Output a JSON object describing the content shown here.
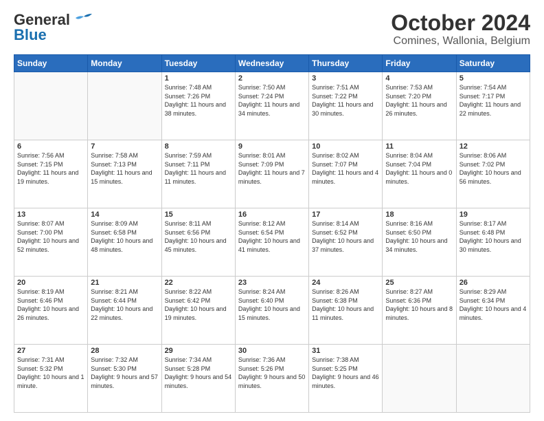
{
  "header": {
    "logo_line1": "General",
    "logo_line2": "Blue",
    "title": "October 2024",
    "subtitle": "Comines, Wallonia, Belgium"
  },
  "weekdays": [
    "Sunday",
    "Monday",
    "Tuesday",
    "Wednesday",
    "Thursday",
    "Friday",
    "Saturday"
  ],
  "weeks": [
    [
      {
        "day": "",
        "sunrise": "",
        "sunset": "",
        "daylight": ""
      },
      {
        "day": "",
        "sunrise": "",
        "sunset": "",
        "daylight": ""
      },
      {
        "day": "1",
        "sunrise": "Sunrise: 7:48 AM",
        "sunset": "Sunset: 7:26 PM",
        "daylight": "Daylight: 11 hours and 38 minutes."
      },
      {
        "day": "2",
        "sunrise": "Sunrise: 7:50 AM",
        "sunset": "Sunset: 7:24 PM",
        "daylight": "Daylight: 11 hours and 34 minutes."
      },
      {
        "day": "3",
        "sunrise": "Sunrise: 7:51 AM",
        "sunset": "Sunset: 7:22 PM",
        "daylight": "Daylight: 11 hours and 30 minutes."
      },
      {
        "day": "4",
        "sunrise": "Sunrise: 7:53 AM",
        "sunset": "Sunset: 7:20 PM",
        "daylight": "Daylight: 11 hours and 26 minutes."
      },
      {
        "day": "5",
        "sunrise": "Sunrise: 7:54 AM",
        "sunset": "Sunset: 7:17 PM",
        "daylight": "Daylight: 11 hours and 22 minutes."
      }
    ],
    [
      {
        "day": "6",
        "sunrise": "Sunrise: 7:56 AM",
        "sunset": "Sunset: 7:15 PM",
        "daylight": "Daylight: 11 hours and 19 minutes."
      },
      {
        "day": "7",
        "sunrise": "Sunrise: 7:58 AM",
        "sunset": "Sunset: 7:13 PM",
        "daylight": "Daylight: 11 hours and 15 minutes."
      },
      {
        "day": "8",
        "sunrise": "Sunrise: 7:59 AM",
        "sunset": "Sunset: 7:11 PM",
        "daylight": "Daylight: 11 hours and 11 minutes."
      },
      {
        "day": "9",
        "sunrise": "Sunrise: 8:01 AM",
        "sunset": "Sunset: 7:09 PM",
        "daylight": "Daylight: 11 hours and 7 minutes."
      },
      {
        "day": "10",
        "sunrise": "Sunrise: 8:02 AM",
        "sunset": "Sunset: 7:07 PM",
        "daylight": "Daylight: 11 hours and 4 minutes."
      },
      {
        "day": "11",
        "sunrise": "Sunrise: 8:04 AM",
        "sunset": "Sunset: 7:04 PM",
        "daylight": "Daylight: 11 hours and 0 minutes."
      },
      {
        "day": "12",
        "sunrise": "Sunrise: 8:06 AM",
        "sunset": "Sunset: 7:02 PM",
        "daylight": "Daylight: 10 hours and 56 minutes."
      }
    ],
    [
      {
        "day": "13",
        "sunrise": "Sunrise: 8:07 AM",
        "sunset": "Sunset: 7:00 PM",
        "daylight": "Daylight: 10 hours and 52 minutes."
      },
      {
        "day": "14",
        "sunrise": "Sunrise: 8:09 AM",
        "sunset": "Sunset: 6:58 PM",
        "daylight": "Daylight: 10 hours and 48 minutes."
      },
      {
        "day": "15",
        "sunrise": "Sunrise: 8:11 AM",
        "sunset": "Sunset: 6:56 PM",
        "daylight": "Daylight: 10 hours and 45 minutes."
      },
      {
        "day": "16",
        "sunrise": "Sunrise: 8:12 AM",
        "sunset": "Sunset: 6:54 PM",
        "daylight": "Daylight: 10 hours and 41 minutes."
      },
      {
        "day": "17",
        "sunrise": "Sunrise: 8:14 AM",
        "sunset": "Sunset: 6:52 PM",
        "daylight": "Daylight: 10 hours and 37 minutes."
      },
      {
        "day": "18",
        "sunrise": "Sunrise: 8:16 AM",
        "sunset": "Sunset: 6:50 PM",
        "daylight": "Daylight: 10 hours and 34 minutes."
      },
      {
        "day": "19",
        "sunrise": "Sunrise: 8:17 AM",
        "sunset": "Sunset: 6:48 PM",
        "daylight": "Daylight: 10 hours and 30 minutes."
      }
    ],
    [
      {
        "day": "20",
        "sunrise": "Sunrise: 8:19 AM",
        "sunset": "Sunset: 6:46 PM",
        "daylight": "Daylight: 10 hours and 26 minutes."
      },
      {
        "day": "21",
        "sunrise": "Sunrise: 8:21 AM",
        "sunset": "Sunset: 6:44 PM",
        "daylight": "Daylight: 10 hours and 22 minutes."
      },
      {
        "day": "22",
        "sunrise": "Sunrise: 8:22 AM",
        "sunset": "Sunset: 6:42 PM",
        "daylight": "Daylight: 10 hours and 19 minutes."
      },
      {
        "day": "23",
        "sunrise": "Sunrise: 8:24 AM",
        "sunset": "Sunset: 6:40 PM",
        "daylight": "Daylight: 10 hours and 15 minutes."
      },
      {
        "day": "24",
        "sunrise": "Sunrise: 8:26 AM",
        "sunset": "Sunset: 6:38 PM",
        "daylight": "Daylight: 10 hours and 11 minutes."
      },
      {
        "day": "25",
        "sunrise": "Sunrise: 8:27 AM",
        "sunset": "Sunset: 6:36 PM",
        "daylight": "Daylight: 10 hours and 8 minutes."
      },
      {
        "day": "26",
        "sunrise": "Sunrise: 8:29 AM",
        "sunset": "Sunset: 6:34 PM",
        "daylight": "Daylight: 10 hours and 4 minutes."
      }
    ],
    [
      {
        "day": "27",
        "sunrise": "Sunrise: 7:31 AM",
        "sunset": "Sunset: 5:32 PM",
        "daylight": "Daylight: 10 hours and 1 minute."
      },
      {
        "day": "28",
        "sunrise": "Sunrise: 7:32 AM",
        "sunset": "Sunset: 5:30 PM",
        "daylight": "Daylight: 9 hours and 57 minutes."
      },
      {
        "day": "29",
        "sunrise": "Sunrise: 7:34 AM",
        "sunset": "Sunset: 5:28 PM",
        "daylight": "Daylight: 9 hours and 54 minutes."
      },
      {
        "day": "30",
        "sunrise": "Sunrise: 7:36 AM",
        "sunset": "Sunset: 5:26 PM",
        "daylight": "Daylight: 9 hours and 50 minutes."
      },
      {
        "day": "31",
        "sunrise": "Sunrise: 7:38 AM",
        "sunset": "Sunset: 5:25 PM",
        "daylight": "Daylight: 9 hours and 46 minutes."
      },
      {
        "day": "",
        "sunrise": "",
        "sunset": "",
        "daylight": ""
      },
      {
        "day": "",
        "sunrise": "",
        "sunset": "",
        "daylight": ""
      }
    ]
  ]
}
